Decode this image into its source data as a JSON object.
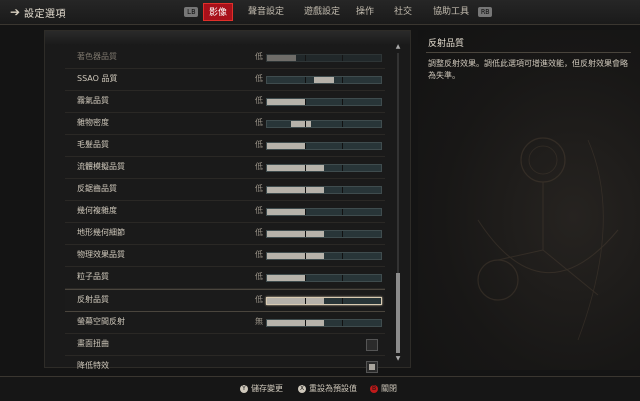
{
  "window": {
    "title": "設定選項"
  },
  "tabs": {
    "left_bumper": "LB",
    "right_bumper": "RB",
    "items": [
      {
        "label": "影像",
        "active": true
      },
      {
        "label": "聲音設定",
        "active": false
      },
      {
        "label": "遊戲設定",
        "active": false
      },
      {
        "label": "操作",
        "active": false
      },
      {
        "label": "社交",
        "active": false
      },
      {
        "label": "協助工具",
        "active": false
      }
    ]
  },
  "settings": [
    {
      "label": "著色器品質",
      "value": "低",
      "type": "slider",
      "level": 0.25,
      "faded": true
    },
    {
      "label": "SSAO 品質",
      "value": "低",
      "type": "slider",
      "level": 0.5,
      "knob": true
    },
    {
      "label": "霧氣品質",
      "value": "低",
      "type": "slider",
      "level": 0.33
    },
    {
      "label": "雜物密度",
      "value": "低",
      "type": "slider",
      "level": 0.3,
      "knob": true
    },
    {
      "label": "毛髮品質",
      "value": "低",
      "type": "slider",
      "level": 0.33
    },
    {
      "label": "流體模擬品質",
      "value": "低",
      "type": "slider",
      "level": 0.5
    },
    {
      "label": "反鋸齒品質",
      "value": "低",
      "type": "slider",
      "level": 0.5
    },
    {
      "label": "幾何複雜度",
      "value": "低",
      "type": "slider",
      "level": 0.33
    },
    {
      "label": "地形幾何細節",
      "value": "低",
      "type": "slider",
      "level": 0.5
    },
    {
      "label": "物理效果品質",
      "value": "低",
      "type": "slider",
      "level": 0.5
    },
    {
      "label": "粒子品質",
      "value": "低",
      "type": "slider",
      "level": 0.33
    },
    {
      "label": "反射品質",
      "value": "低",
      "type": "slider",
      "level": 0.5,
      "selected": true
    },
    {
      "label": "螢幕空間反射",
      "value": "無",
      "type": "slider",
      "level": 0.5
    },
    {
      "label": "畫面扭曲",
      "type": "checkbox",
      "checked": false
    },
    {
      "label": "降低特效",
      "type": "checkbox",
      "checked": true
    }
  ],
  "info": {
    "title": "反射品質",
    "description": "調整反射效果。調低此選項可增進效能，但反射效果會略為失準。"
  },
  "footer": {
    "save": {
      "button": "Y",
      "label": "儲存變更"
    },
    "reset": {
      "button": "X",
      "label": "重設為預設值"
    },
    "close": {
      "button": "B",
      "label": "關閉"
    }
  },
  "colors": {
    "accent": "#a8101a",
    "slider_fill": "#b6b2aa",
    "slider_track": "#283538"
  },
  "icons": {
    "back": "back-arrow-icon",
    "scroll_up": "scroll-up-icon",
    "scroll_down": "scroll-down-icon"
  }
}
